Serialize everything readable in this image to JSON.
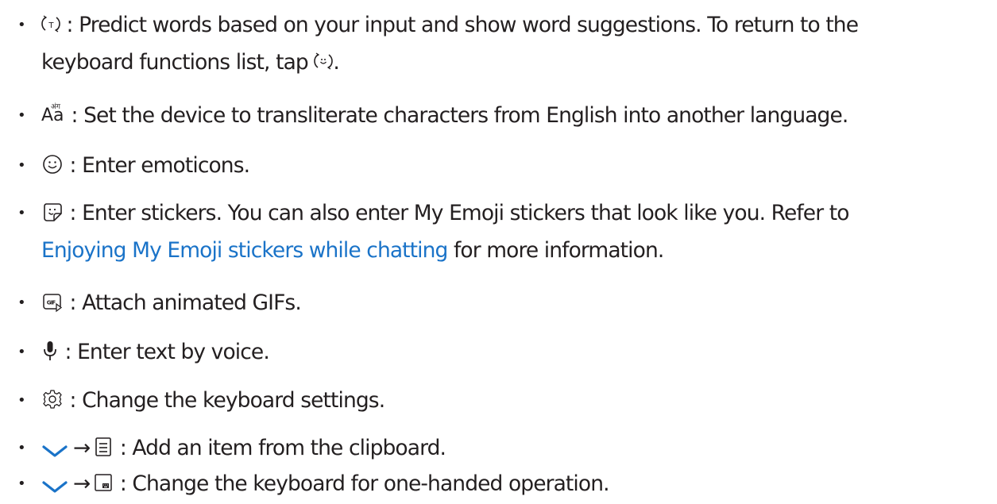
{
  "items": [
    {
      "icon": "predictive-text-icon",
      "text": ": Predict words based on your input and show word suggestions. To return to the",
      "text2a": "keyboard functions list, tap ",
      "icon2": "keyboard-functions-icon",
      "text2b": "."
    },
    {
      "icon": "transliterate-icon",
      "glyph_top": "अंग",
      "glyph_bottom": "Aa",
      "text": ": Set the device to transliterate characters from English into another language."
    },
    {
      "icon": "emoticon-icon",
      "text": ": Enter emoticons."
    },
    {
      "icon": "sticker-icon",
      "text": ": Enter stickers. You can also enter My Emoji stickers that look like you. Refer to",
      "link": "Enjoying My Emoji stickers while chatting",
      "text2": " for more information."
    },
    {
      "icon": "gif-icon",
      "glyph": "GIF",
      "text": ": Attach animated GIFs."
    },
    {
      "icon": "microphone-icon",
      "text": ": Enter text by voice."
    },
    {
      "icon": "settings-gear-icon",
      "text": ": Change the keyboard settings."
    },
    {
      "icon": "chevron-down-icon",
      "arrow": "→",
      "icon2": "clipboard-icon",
      "text": ": Add an item from the clipboard."
    },
    {
      "icon": "chevron-down-icon",
      "arrow": "→",
      "icon2": "one-handed-keyboard-icon",
      "text": ": Change the keyboard for one-handed operation."
    }
  ],
  "colors": {
    "text": "#231f20",
    "link": "#1a73c8",
    "chevron": "#1a73c8"
  }
}
